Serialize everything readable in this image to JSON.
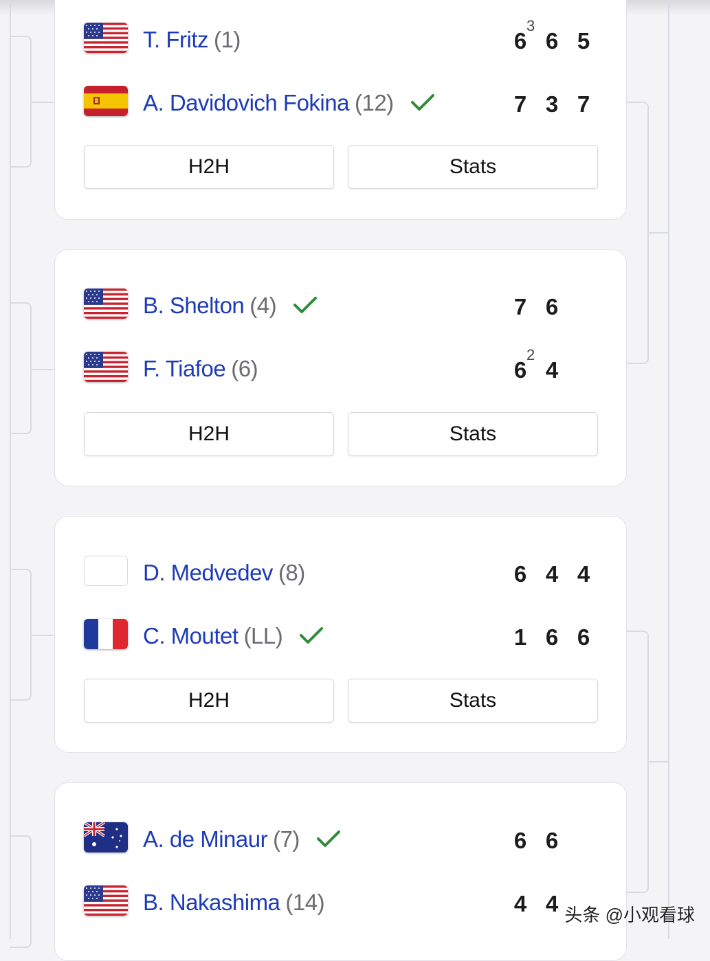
{
  "matches": [
    {
      "players": [
        {
          "name": "T. Fritz",
          "seed": "(1)",
          "flag": "usa-flag",
          "winner": false,
          "scores": [
            "6",
            "6",
            "5"
          ],
          "tiebreaks": [
            "3",
            "",
            ""
          ]
        },
        {
          "name": "A. Davidovich Fokina",
          "seed": "(12)",
          "flag": "spain-flag",
          "winner": true,
          "scores": [
            "7",
            "3",
            "7"
          ],
          "tiebreaks": [
            "",
            "",
            ""
          ]
        }
      ],
      "h2h_label": "H2H",
      "stats_label": "Stats"
    },
    {
      "players": [
        {
          "name": "B. Shelton",
          "seed": "(4)",
          "flag": "usa-flag",
          "winner": true,
          "scores": [
            "7",
            "6"
          ],
          "tiebreaks": [
            "",
            ""
          ]
        },
        {
          "name": "F. Tiafoe",
          "seed": "(6)",
          "flag": "usa-flag",
          "winner": false,
          "scores": [
            "6",
            "4"
          ],
          "tiebreaks": [
            "2",
            ""
          ]
        }
      ],
      "h2h_label": "H2H",
      "stats_label": "Stats"
    },
    {
      "players": [
        {
          "name": "D. Medvedev",
          "seed": "(8)",
          "flag": "blank-flag",
          "winner": false,
          "scores": [
            "6",
            "4",
            "4"
          ],
          "tiebreaks": [
            "",
            "",
            ""
          ]
        },
        {
          "name": "C. Moutet",
          "seed": "(LL)",
          "flag": "france-flag",
          "winner": true,
          "scores": [
            "1",
            "6",
            "6"
          ],
          "tiebreaks": [
            "",
            "",
            ""
          ]
        }
      ],
      "h2h_label": "H2H",
      "stats_label": "Stats"
    },
    {
      "players": [
        {
          "name": "A. de Minaur",
          "seed": "(7)",
          "flag": "australia-flag",
          "winner": true,
          "scores": [
            "6",
            "6"
          ],
          "tiebreaks": [
            "",
            ""
          ]
        },
        {
          "name": "B. Nakashima",
          "seed": "(14)",
          "flag": "usa-flag",
          "winner": false,
          "scores": [
            "4",
            "4"
          ],
          "tiebreaks": [
            "",
            ""
          ]
        }
      ],
      "h2h_label": "H2H",
      "stats_label": "Stats"
    }
  ],
  "watermark": "头条 @小观看球",
  "colors": {
    "player_name": "#1d3bb8",
    "check": "#2e8b3a",
    "bracket_line": "#d9dbe2"
  }
}
